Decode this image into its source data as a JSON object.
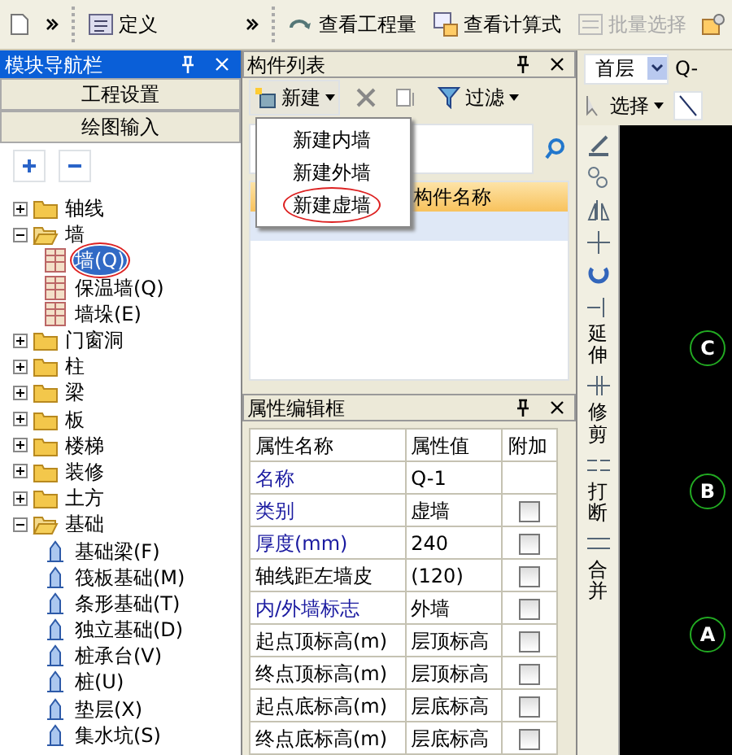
{
  "toolbar": {
    "buttons": [
      {
        "label": "定义",
        "disabled": false
      },
      {
        "label": "查看工程量",
        "disabled": false
      },
      {
        "label": "查看计算式",
        "disabled": false
      },
      {
        "label": "批量选择",
        "disabled": true
      }
    ]
  },
  "nav_panel": {
    "title": "模块导航栏",
    "sections": [
      "工程设置",
      "绘图输入"
    ],
    "tree": [
      {
        "label": "轴线",
        "kind": "folder",
        "expanded": false
      },
      {
        "label": "墙",
        "kind": "folder",
        "expanded": true,
        "children": [
          {
            "label": "墙(Q)",
            "kind": "component",
            "selected": true,
            "circled": true
          },
          {
            "label": "保温墙(Q)",
            "kind": "component",
            "selected": false,
            "circled": false
          },
          {
            "label": "墙垛(E)",
            "kind": "component",
            "selected": false,
            "circled": false
          }
        ]
      },
      {
        "label": "门窗洞",
        "kind": "folder",
        "expanded": false
      },
      {
        "label": "柱",
        "kind": "folder",
        "expanded": false
      },
      {
        "label": "梁",
        "kind": "folder",
        "expanded": false
      },
      {
        "label": "板",
        "kind": "folder",
        "expanded": false
      },
      {
        "label": "楼梯",
        "kind": "folder",
        "expanded": false
      },
      {
        "label": "装修",
        "kind": "folder",
        "expanded": false
      },
      {
        "label": "土方",
        "kind": "folder",
        "expanded": false
      },
      {
        "label": "基础",
        "kind": "folder",
        "expanded": true,
        "children": [
          {
            "label": "基础梁(F)",
            "kind": "component",
            "selected": false,
            "circled": false
          },
          {
            "label": "筏板基础(M)",
            "kind": "component",
            "selected": false,
            "circled": false
          },
          {
            "label": "条形基础(T)",
            "kind": "component",
            "selected": false,
            "circled": false
          },
          {
            "label": "独立基础(D)",
            "kind": "component",
            "selected": false,
            "circled": false
          },
          {
            "label": "桩承台(V)",
            "kind": "component",
            "selected": false,
            "circled": false
          },
          {
            "label": "桩(U)",
            "kind": "component",
            "selected": false,
            "circled": false
          },
          {
            "label": "垫层(X)",
            "kind": "component",
            "selected": false,
            "circled": false
          },
          {
            "label": "集水坑(S)",
            "kind": "component",
            "selected": false,
            "circled": false
          }
        ]
      }
    ]
  },
  "component_list": {
    "title": "构件列表",
    "new_button": "新建",
    "filter_button": "过滤",
    "column": "构件名称",
    "new_menu": [
      {
        "label": "新建内墙",
        "circled": false
      },
      {
        "label": "新建外墙",
        "circled": false
      },
      {
        "label": "新建虚墙",
        "circled": true
      }
    ]
  },
  "property_editor": {
    "title": "属性编辑框",
    "columns": [
      "属性名称",
      "属性值",
      "附加"
    ],
    "rows": [
      {
        "name": "名称",
        "value": "Q-1",
        "highlighted": true
      },
      {
        "name": "类别",
        "value": "虚墙",
        "highlighted": true,
        "checked": false
      },
      {
        "name": "厚度(mm)",
        "value": "240",
        "highlighted": true,
        "checked": false
      },
      {
        "name": "轴线距左墙皮",
        "value": "(120)",
        "highlighted": false,
        "checked": false
      },
      {
        "name": "内/外墙标志",
        "value": "外墙",
        "highlighted": true,
        "checked": false
      },
      {
        "name": "起点顶标高(m)",
        "value": "层顶标高",
        "highlighted": false,
        "checked": false
      },
      {
        "name": "终点顶标高(m)",
        "value": "层顶标高",
        "highlighted": false,
        "checked": false
      },
      {
        "name": "起点底标高(m)",
        "value": "层底标高",
        "highlighted": false,
        "checked": false
      },
      {
        "name": "终点底标高(m)",
        "value": "层底标高",
        "highlighted": false,
        "checked": false
      }
    ]
  },
  "drawing_toolbar": {
    "floor": "首层",
    "component": "Q-",
    "select_button": "选择",
    "tools": [
      "延伸",
      "修剪",
      "打断",
      "合并"
    ]
  },
  "canvas": {
    "axis_labels": [
      "C",
      "B",
      "A"
    ]
  }
}
